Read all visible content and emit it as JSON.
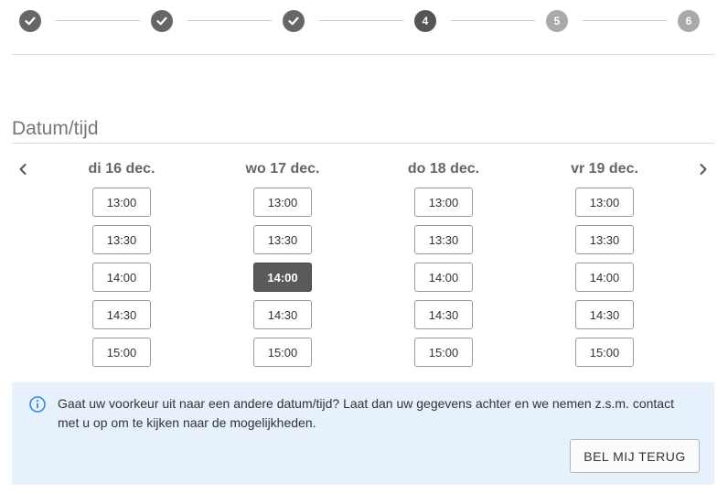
{
  "stepper": {
    "steps": [
      {
        "status": "done",
        "label": ""
      },
      {
        "status": "done",
        "label": ""
      },
      {
        "status": "done",
        "label": ""
      },
      {
        "status": "active",
        "label": "4"
      },
      {
        "status": "pending",
        "label": "5"
      },
      {
        "status": "pending",
        "label": "6"
      }
    ]
  },
  "page": {
    "title": "Datum/tijd"
  },
  "calendar": {
    "prev_icon": "chevron-left-icon",
    "next_icon": "chevron-right-icon",
    "days": [
      {
        "label": "di 16 dec.",
        "slots": [
          "13:00",
          "13:30",
          "14:00",
          "14:30",
          "15:00"
        ]
      },
      {
        "label": "wo 17 dec.",
        "slots": [
          "13:00",
          "13:30",
          "14:00",
          "14:30",
          "15:00"
        ]
      },
      {
        "label": "do 18 dec.",
        "slots": [
          "13:00",
          "13:30",
          "14:00",
          "14:30",
          "15:00"
        ]
      },
      {
        "label": "vr 19 dec.",
        "slots": [
          "13:00",
          "13:30",
          "14:00",
          "14:30",
          "15:00"
        ]
      }
    ],
    "selected": {
      "day": 1,
      "slot": 2
    }
  },
  "info": {
    "icon": "info-icon",
    "text": "Gaat uw voorkeur uit naar een andere datum/tijd? Laat dan uw gegevens achter en we nemen z.s.m. contact met u op om te kijken naar de mogelijkheden.",
    "button_label": "BEL MIJ TERUG",
    "accent_color": "#3a86d8"
  }
}
